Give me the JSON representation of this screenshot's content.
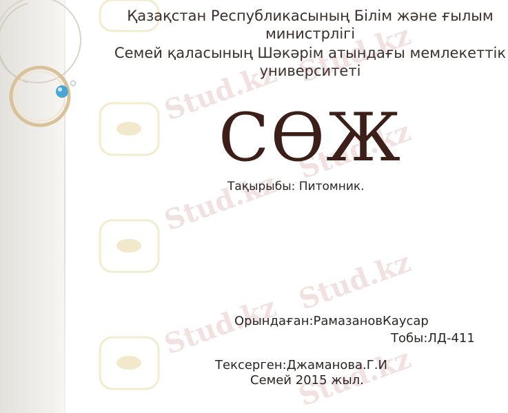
{
  "slide": {
    "ministry": "Қазақстан Республикасының Білім және ғылым министрлігі",
    "university": "Семей қаласының Шәкәрім атындағы мемлекеттік университеті",
    "title": "СӨЖ",
    "topic": "Тақырыбы: Питомник.",
    "performer": "Орындаған:РамазановКаусар",
    "group": "Тобы:ЛД-411",
    "checker": "Тексерген:Джаманова.Г.И",
    "city_year": "Семей 2015 жыл."
  },
  "watermark": {
    "text": "Stud.kz"
  },
  "colors": {
    "title": "#3b1f18",
    "text": "#2a2522",
    "ring": "#d9c29a",
    "watermark": "#e6c8c8"
  }
}
